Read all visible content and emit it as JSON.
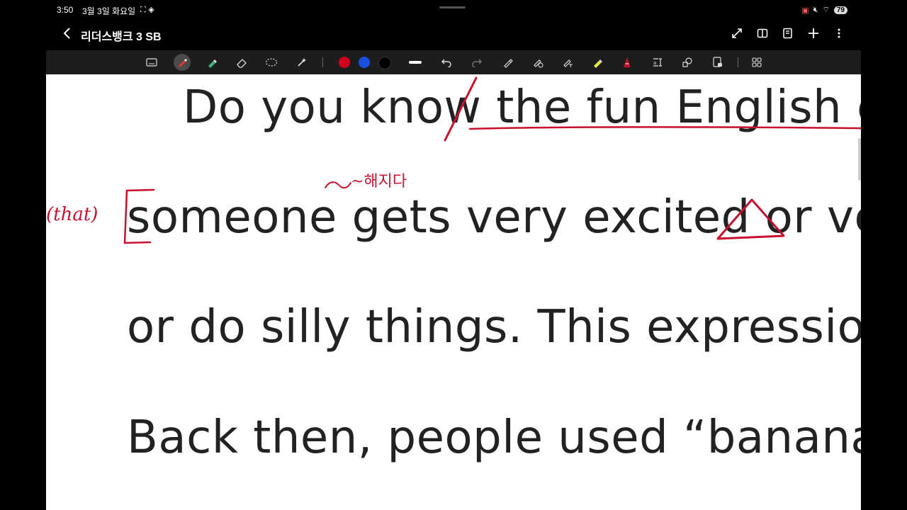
{
  "status_bar": {
    "time": "3:50",
    "date": "3월 3일 화요일",
    "battery": "79"
  },
  "title_bar": {
    "title": "리더스뱅크 3 SB"
  },
  "toolbar": {
    "tools": [
      "keyboard-icon",
      "pen-icon",
      "highlighter-icon",
      "eraser-icon",
      "lasso-icon",
      "magic-icon"
    ],
    "active_tool": "pen-icon",
    "colors": [
      "#d0021b",
      "#1a4fe0",
      "#000000"
    ]
  },
  "document": {
    "lines": [
      "Do you know the fun English exp",
      "someone gets very excited or ver",
      "or do silly things. This expression",
      "Back then, people used “banana"
    ]
  },
  "annotations": {
    "that_note": "(that)",
    "korean_note": "~해지다"
  },
  "colors": {
    "ink": "#c8102e",
    "toolbar_bg": "#1d1d1d",
    "page_bg": "#ffffff"
  }
}
